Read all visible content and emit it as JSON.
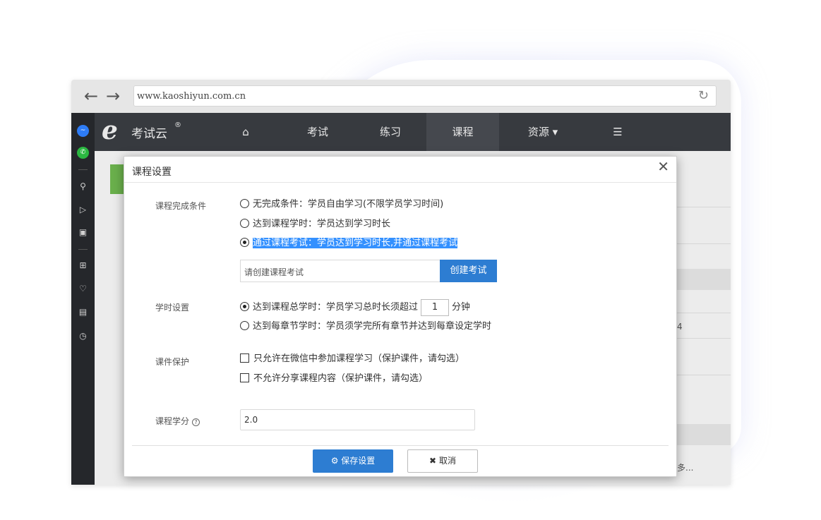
{
  "browser": {
    "url": "www.kaoshiyun.com.cn",
    "back_icon": "arrow-left-icon",
    "forward_icon": "arrow-right-icon",
    "reload_icon": "reload-icon"
  },
  "logo": {
    "mark": "e",
    "name": "考试云",
    "reg": "®"
  },
  "nav": {
    "items": [
      {
        "label": "",
        "icon": "home-icon"
      },
      {
        "label": "考试"
      },
      {
        "label": "练习"
      },
      {
        "label": "课程",
        "active": true
      },
      {
        "label": "资源 ▾"
      },
      {
        "label": "",
        "icon": "list-icon"
      }
    ]
  },
  "background_fragments": {
    "row_text_1": "4",
    "row_text_2": "多..."
  },
  "modal": {
    "title": "课程设置",
    "close": "✕",
    "completion": {
      "label": "课程完成条件",
      "options": [
        {
          "text": "无完成条件：学员自由学习(不限学员学习时间)",
          "checked": false
        },
        {
          "text": "达到课程学时：学员达到学习时长",
          "checked": false
        },
        {
          "text": "通过课程考试：学员达到学习时长,并通过课程考试",
          "checked": true
        }
      ],
      "exam_placeholder": "请创建课程考试",
      "create_exam_button": "创建考试"
    },
    "hours": {
      "label": "学时设置",
      "option1_prefix": "达到课程总学时：学员学习总时长须超过",
      "option1_value": "1",
      "option1_suffix": "分钟",
      "option1_checked": true,
      "option2": "达到每章节学时：学员须学完所有章节并达到每章设定学时",
      "option2_checked": false
    },
    "protection": {
      "label": "课件保护",
      "options": [
        {
          "text": "只允许在微信中参加课程学习（保护课件，请勾选）",
          "checked": false
        },
        {
          "text": "不允许分享课程内容（保护课件，请勾选）",
          "checked": false
        }
      ]
    },
    "credit": {
      "label": "课程学分",
      "help": "?",
      "value": "2.0"
    },
    "footer": {
      "save_label": "保存设置",
      "cancel_label": "取消",
      "save_icon": "gear-icon",
      "cancel_icon": "x-icon"
    }
  },
  "colors": {
    "primary": "#2d7dd2",
    "nav_bg": "#373a3f",
    "highlight": "#3390ff",
    "green": "#6ab04c"
  }
}
